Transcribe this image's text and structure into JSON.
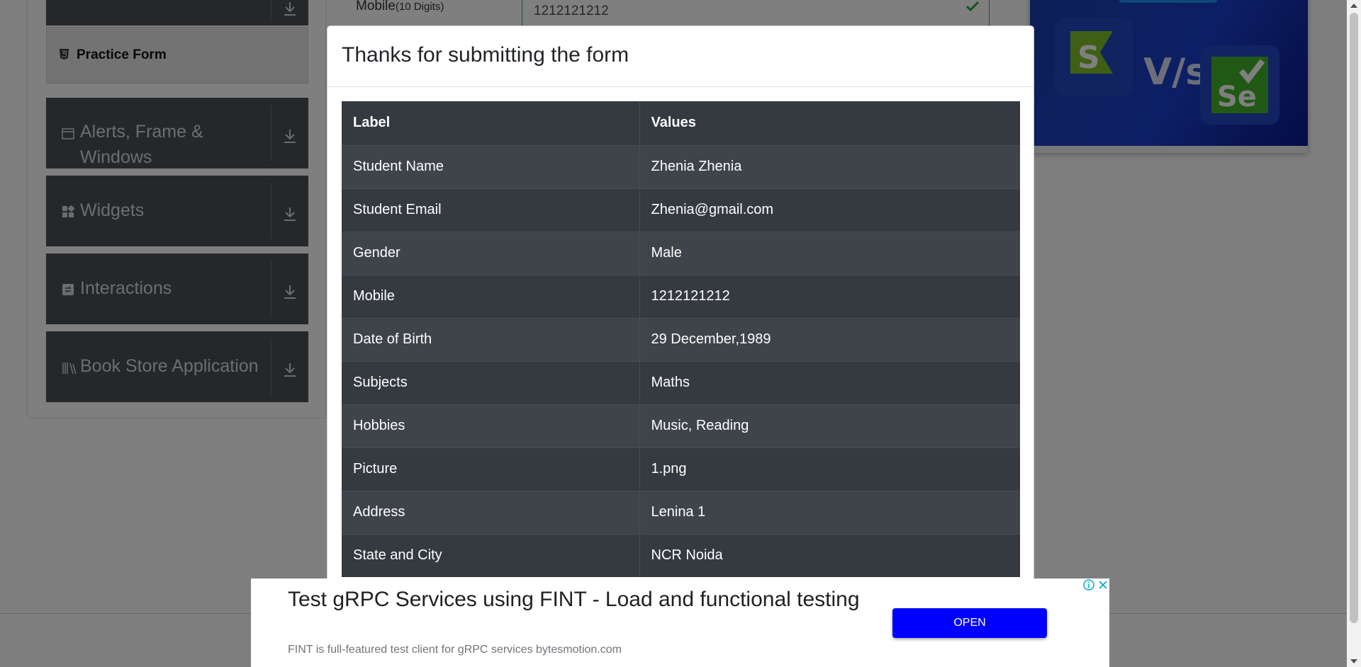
{
  "background": {
    "sidebar": {
      "active_item": "Practice Form",
      "groups": [
        {
          "label": "Alerts, Frame & Windows"
        },
        {
          "label": "Widgets"
        },
        {
          "label": "Interactions"
        },
        {
          "label": "Book Store Application"
        }
      ]
    },
    "form": {
      "mobile_label": "Mobile",
      "mobile_hint": "(10 Digits)",
      "mobile_value": "1212121212"
    },
    "banner": {
      "vs_text": "V/s"
    }
  },
  "modal": {
    "title": "Thanks for submitting the form",
    "columns": [
      "Label",
      "Values"
    ],
    "rows": [
      {
        "label": "Student Name",
        "value": "Zhenia Zhenia"
      },
      {
        "label": "Student Email",
        "value": "Zhenia@gmail.com"
      },
      {
        "label": "Gender",
        "value": "Male"
      },
      {
        "label": "Mobile",
        "value": "1212121212"
      },
      {
        "label": "Date of Birth",
        "value": "29 December,1989"
      },
      {
        "label": "Subjects",
        "value": "Maths"
      },
      {
        "label": "Hobbies",
        "value": "Music, Reading"
      },
      {
        "label": "Picture",
        "value": "1.png"
      },
      {
        "label": "Address",
        "value": "Lenina 1"
      },
      {
        "label": "State and City",
        "value": "NCR Noida"
      }
    ]
  },
  "ad": {
    "title": "Test gRPC Services using FINT - Load and functional testing",
    "description": "FINT is full-featured test client for gRPC services bytesmotion.com",
    "button_label": "OPEN"
  },
  "colors": {
    "table_dark": "#343a40",
    "table_stripe": "#3e444a",
    "ad_button": "#0000ff",
    "sidebar_group": "#4b5157"
  }
}
